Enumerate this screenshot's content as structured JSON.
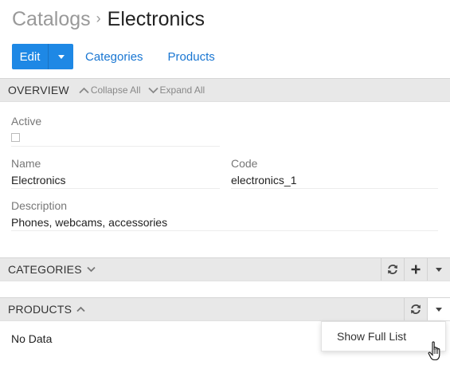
{
  "breadcrumb": {
    "parent": "Catalogs",
    "separator": "›",
    "current": "Electronics"
  },
  "actions": {
    "edit_label": "Edit",
    "links": [
      "Categories",
      "Products"
    ]
  },
  "overview": {
    "title": "OVERVIEW",
    "collapse_all": "Collapse All",
    "expand_all": "Expand All",
    "fields": {
      "active": {
        "label": "Active",
        "checked": false
      },
      "name": {
        "label": "Name",
        "value": "Electronics"
      },
      "code": {
        "label": "Code",
        "value": "electronics_1"
      },
      "description": {
        "label": "Description",
        "value": "Phones, webcams, accessories"
      }
    }
  },
  "categories": {
    "title": "CATEGORIES"
  },
  "products": {
    "title": "PRODUCTS",
    "empty_text": "No Data"
  },
  "dropdown": {
    "items": [
      "Show Full List"
    ]
  },
  "colors": {
    "accent": "#1e88e5",
    "link": "#1976d2",
    "header_bg": "#e8e8e8"
  }
}
